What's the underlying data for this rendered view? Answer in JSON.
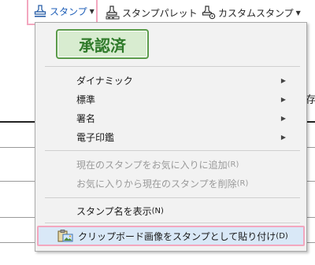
{
  "toolbar": {
    "stamp_label": "スタンプ",
    "palette_label": "スタンプパレット",
    "custom_label": "カスタムスタンプ"
  },
  "background": {
    "char": "存"
  },
  "menu": {
    "preview_text": "承認済",
    "items": [
      {
        "label": "ダイナミック"
      },
      {
        "label": "標準"
      },
      {
        "label": "署名"
      },
      {
        "label": "電子印鑑"
      }
    ],
    "favorite_add": {
      "label": "現在のスタンプをお気に入りに追加",
      "accel": "(R)"
    },
    "favorite_remove": {
      "label": "お気に入りから現在のスタンプを削除",
      "accel": "(R)"
    },
    "show_name": {
      "label": "スタンプ名を表示",
      "accel": "(N)"
    },
    "paste_clipboard": {
      "label": "クリップボード画像をスタンプとして貼り付け",
      "accel": "(D)"
    }
  }
}
